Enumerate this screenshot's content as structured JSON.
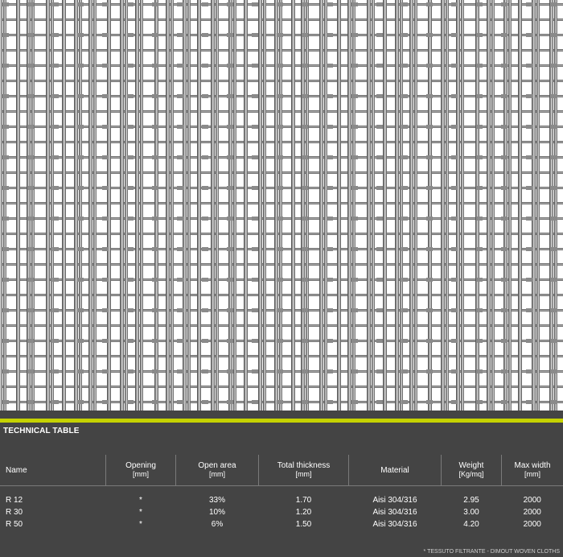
{
  "technical_table": {
    "title": "TECHNICAL TABLE",
    "accent_color": "#c5d200",
    "columns": [
      {
        "label": "Name",
        "unit": ""
      },
      {
        "label": "Opening",
        "unit": "[mm]"
      },
      {
        "label": "Open area",
        "unit": "[mm]"
      },
      {
        "label": "Total thickness",
        "unit": "[mm]"
      },
      {
        "label": "Material",
        "unit": ""
      },
      {
        "label": "Weight",
        "unit": "[Kg/mq]"
      },
      {
        "label": "Max width",
        "unit": "[mm]"
      }
    ],
    "rows": [
      [
        "R 12",
        "*",
        "33%",
        "1.70",
        "Aisi 304/316",
        "2.95",
        "2000"
      ],
      [
        "R 30",
        "*",
        "10%",
        "1.20",
        "Aisi 304/316",
        "3.00",
        "2000"
      ],
      [
        "R 50",
        "*",
        "6%",
        "1.50",
        "Aisi 304/316",
        "4.20",
        "2000"
      ]
    ],
    "footnote": "* TESSUTO FILTRANTE - DIMOUT WOVEN CLOTHS"
  }
}
